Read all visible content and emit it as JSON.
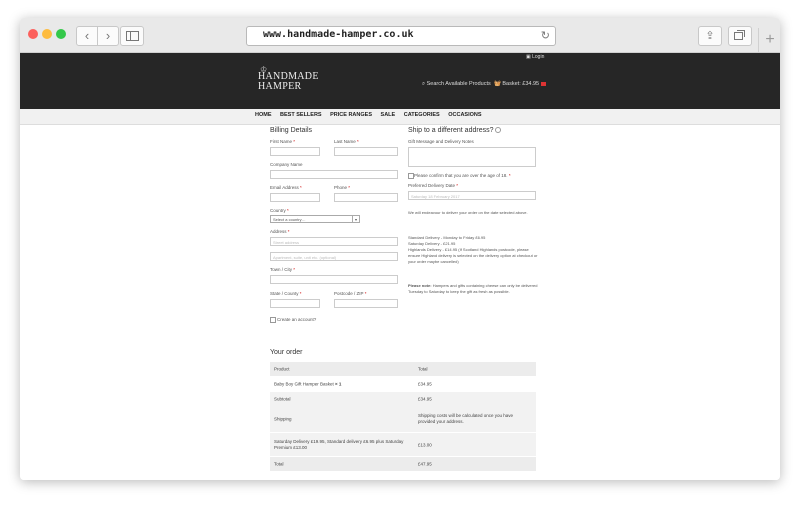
{
  "browser": {
    "url": "www.handmade-hamper.co.uk",
    "back_glyph": "‹",
    "forward_glyph": "›",
    "reload_glyph": "↻",
    "share_glyph": "⇪",
    "new_tab_glyph": "+"
  },
  "header": {
    "login": "Login",
    "logo_line1": "HANDMADE",
    "logo_line2": "HAMPER",
    "search": "Search Available Products",
    "basket": "Basket: £34.95"
  },
  "menu": [
    "HOME",
    "BEST SELLERS",
    "PRICE RANGES",
    "SALE",
    "CATEGORIES",
    "OCCASIONS"
  ],
  "billing": {
    "title": "Billing Details",
    "first_name": "First Name",
    "last_name": "Last Name",
    "company_name": "Company Name",
    "email": "Email Address",
    "phone": "Phone",
    "country": "Country",
    "country_select": "Select a country…",
    "address": "Address",
    "address_placeholder": "Street address",
    "address2_placeholder": "Apartment, suite, unit etc. (optional)",
    "town": "Town / City",
    "state": "State / County",
    "postcode": "Postcode / ZIP",
    "create_account": "Create an account?",
    "required_mark": "*"
  },
  "shipping": {
    "title": "Ship to a different address?",
    "gift_notes": "Gift Message and Delivery Notes",
    "age_confirm": "Please confirm that you are over the age of 18.",
    "delivery_date_label": "Preferred Delivery Date",
    "delivery_date_value": "Saturday 18 February 2017",
    "note1": "We will endeavour to deliver your order on the date selected above.",
    "rate_std": "Standard Delivery - Monday to Friday £6.95",
    "rate_sat": "Saturday Delivery - £21.95",
    "rate_high": "Highlands Delivery - £14.95 (If Scotland Highlands postcode, please ensure Highland delivery is selected on the delivery option at checkout or your order maybe cancelled)",
    "note2_bold": "Please note:",
    "note2": "Hampers and gifts containing cheese can only be delivered Tuesday to Saturday to keep the gift as fresh as possible."
  },
  "order": {
    "title": "Your order",
    "col_product": "Product",
    "col_total": "Total",
    "item_name": "Baby Boy Gift Hamper Basket",
    "item_qty": "× 1",
    "item_total": "£34.95",
    "subtotal_label": "Subtotal",
    "subtotal_value": "£34.95",
    "shipping_label": "Shipping",
    "shipping_value": "Shipping costs will be calculated once you have provided your address.",
    "saturday_label": "Saturday Delivery £19.95, Standard delivery £6.95 plus Saturday Premium £13.00",
    "saturday_value": "£13.00",
    "total_label": "Total",
    "total_value": "£47.95"
  }
}
